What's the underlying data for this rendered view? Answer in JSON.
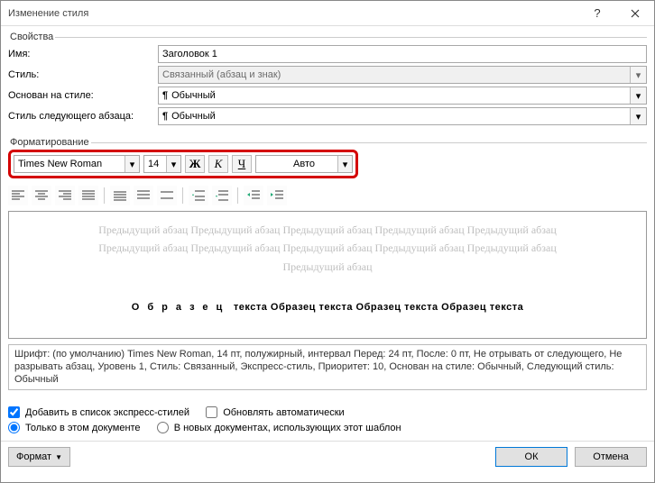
{
  "title": "Изменение стиля",
  "props": {
    "legend": "Свойства",
    "name_label": "Имя:",
    "name_value": "Заголовок 1",
    "type_label": "Стиль:",
    "type_value": "Связанный (абзац и знак)",
    "based_label": "Основан на стиле:",
    "based_value": "Обычный",
    "next_label": "Стиль следующего абзаца:",
    "next_value": "Обычный"
  },
  "fmt": {
    "legend": "Форматирование",
    "font": "Times New Roman",
    "size": "14",
    "bold": "Ж",
    "italic": "К",
    "underline": "Ч",
    "color": "Авто"
  },
  "preview": {
    "prev_line1": "Предыдущий абзац Предыдущий абзац Предыдущий абзац Предыдущий абзац Предыдущий абзац",
    "prev_line2": "Предыдущий абзац Предыдущий абзац Предыдущий абзац Предыдущий абзац Предыдущий абзац",
    "prev_line3": "Предыдущий абзац",
    "sample_spaced": "Образец",
    "sample_rest": " текста Образец текста Образец текста Образец текста"
  },
  "description": "Шрифт: (по умолчанию) Times New Roman, 14 пт, полужирный, интервал Перед:  24 пт, После:  0 пт, Не отрывать от следующего, Не разрывать абзац, Уровень 1, Стиль: Связанный, Экспресс-стиль, Приоритет: 10, Основан на стиле: Обычный, Следующий стиль: Обычный",
  "checks": {
    "add_quick": "Добавить в список экспресс-стилей",
    "auto_update": "Обновлять автоматически",
    "only_doc": "Только в этом документе",
    "new_docs": "В новых документах, использующих этот шаблон"
  },
  "buttons": {
    "format": "Формат",
    "ok": "ОК",
    "cancel": "Отмена"
  }
}
